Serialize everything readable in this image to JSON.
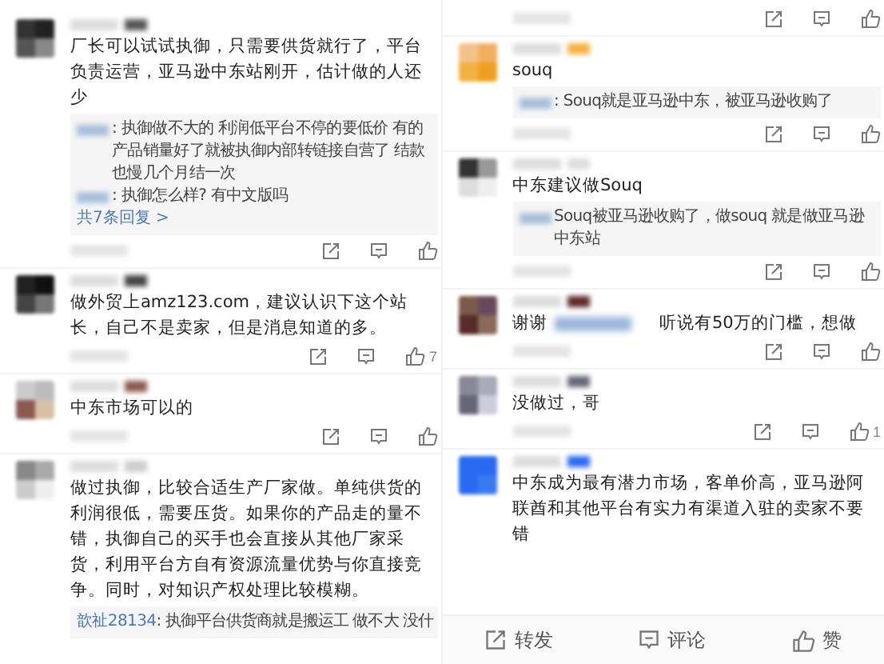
{
  "columns": [
    {
      "comments": [
        {
          "kind": "comment",
          "text": "厂长可以试试执御，只需要供货就行了，平台负责运营，亚马逊中东站刚开，估计做的人还少",
          "replies": [
            {
              "text": ": 执御做不大的 利润低平台不停的要低价 有的产品销量好了就被执御内部转链接自营了 结款也慢几个月结一次"
            },
            {
              "text": ": 执御怎么样? 有中文版吗"
            }
          ],
          "more": "共7条回复 >"
        },
        {
          "kind": "comment",
          "text": "做外贸上amz123.com，建议认识下这个站长，自己不是卖家，但是消息知道的多。",
          "likes": "7"
        },
        {
          "kind": "comment",
          "text": "中东市场可以的"
        },
        {
          "kind": "comment",
          "text": "做过执御，比较合适生产厂家做。单纯供货的利润很低，需要压货。如果你的产品走的量不错，执御自己的买手也会直接从其他厂家采货，利用平台方自有资源流量优势与你直接竞争。同时，对知识产权处理比较模糊。",
          "replies": [
            {
              "author": "歆祉28134",
              "text": ": 执御平台供货商就是搬运工 做不大 没什"
            }
          ],
          "cut": true
        }
      ]
    },
    {
      "comments": [
        {
          "kind": "tail"
        },
        {
          "kind": "comment",
          "text": "souq",
          "replies": [
            {
              "text": ": Souq就是亚马逊中东，被亚马逊收购了"
            }
          ]
        },
        {
          "kind": "comment",
          "text": "中东建议做Souq",
          "replies": [
            {
              "text": "Souq被亚马逊收购了，做souq 就是做亚马逊中东站"
            }
          ]
        },
        {
          "kind": "split",
          "parts": [
            "谢谢",
            "听说有50万的门槛，想做"
          ]
        },
        {
          "kind": "comment",
          "text": "没做过，哥",
          "likes": "1"
        },
        {
          "kind": "comment",
          "text": "中东成为最有潜力市场，客单价高，亚马逊阿联酋和其他平台有实力有渠道入驻的卖家不要错",
          "cut": true
        }
      ]
    }
  ],
  "bottom_bar": [
    {
      "kind": "share",
      "label": "转发"
    },
    {
      "kind": "comment",
      "label": "评论"
    },
    {
      "kind": "like",
      "label": "赞"
    }
  ]
}
